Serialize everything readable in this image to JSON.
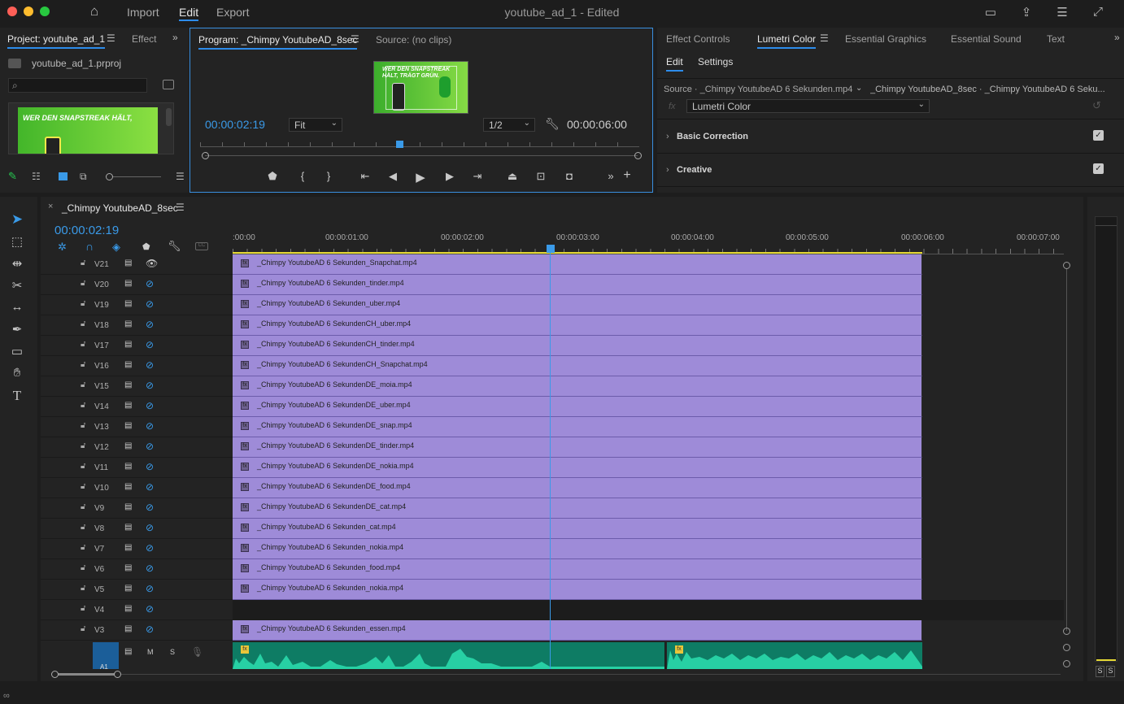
{
  "menubar": {
    "items": [
      {
        "label": "Import",
        "active": false
      },
      {
        "label": "Edit",
        "active": true
      },
      {
        "label": "Export",
        "active": false
      }
    ],
    "window_title": "youtube_ad_1 - Edited"
  },
  "project_panel": {
    "tab_label": "Project: youtube_ad_1",
    "tab2_label": "Effect",
    "file_name": "youtube_ad_1.prproj",
    "thumbnail_text": "WER DEN SNAPSTREAK HÄLT,"
  },
  "program_monitor": {
    "tab_label": "Program: _Chimpy YoutubeAD_8sec",
    "source_tab_label": "Source: (no clips)",
    "thumbnail_text": "WER DEN SNAPSTREAK HÄLT, TRÄGT GRÜN.",
    "current_time": "00:00:02:19",
    "zoom_select": "Fit",
    "resolution_select": "1/2",
    "duration": "00:00:06:00",
    "playhead_position": 0.46
  },
  "right_panel": {
    "tabs": [
      "Effect Controls",
      "Lumetri Color",
      "Essential Graphics",
      "Essential Sound",
      "Text"
    ],
    "active_tab": "Lumetri Color",
    "subtabs": [
      "Edit",
      "Settings"
    ],
    "source_label": "Source · _Chimpy YoutubeAD 6 Sekunden.mp4",
    "source_path": "_Chimpy YoutubeAD_8sec · _Chimpy YoutubeAD 6 Seku...",
    "fx_label": "fx",
    "effect_select": "Lumetri Color",
    "sections": [
      {
        "label": "Basic Correction",
        "checked": true
      },
      {
        "label": "Creative",
        "checked": true
      }
    ]
  },
  "timeline": {
    "tab_label": "_Chimpy YoutubeAD_8sec",
    "current_time": "00:00:02:19",
    "ruler_labels": [
      ":00:00",
      "00:00:01:00",
      "00:00:02:00",
      "00:00:03:00",
      "00:00:04:00",
      "00:00:05:00",
      "00:00:06:00",
      "00:00:07:00"
    ],
    "tracks": [
      {
        "name": "V21",
        "clip": "_Chimpy YoutubeAD 6 Sekunden_Snapchat.mp4",
        "visible": true
      },
      {
        "name": "V20",
        "clip": "_Chimpy YoutubeAD 6 Sekunden_tinder.mp4",
        "visible": false
      },
      {
        "name": "V19",
        "clip": "_Chimpy YoutubeAD 6 Sekunden_uber.mp4",
        "visible": false
      },
      {
        "name": "V18",
        "clip": "_Chimpy YoutubeAD 6 SekundenCH_uber.mp4",
        "visible": false
      },
      {
        "name": "V17",
        "clip": "_Chimpy YoutubeAD 6 SekundenCH_tinder.mp4",
        "visible": false
      },
      {
        "name": "V16",
        "clip": "_Chimpy YoutubeAD 6 SekundenCH_Snapchat.mp4",
        "visible": false
      },
      {
        "name": "V15",
        "clip": "_Chimpy YoutubeAD 6 SekundenDE_moia.mp4",
        "visible": false
      },
      {
        "name": "V14",
        "clip": "_Chimpy YoutubeAD 6 SekundenDE_uber.mp4",
        "visible": false
      },
      {
        "name": "V13",
        "clip": "_Chimpy YoutubeAD 6 SekundenDE_snap.mp4",
        "visible": false
      },
      {
        "name": "V12",
        "clip": "_Chimpy YoutubeAD 6 SekundenDE_tinder.mp4",
        "visible": false
      },
      {
        "name": "V11",
        "clip": "_Chimpy YoutubeAD 6 SekundenDE_nokia.mp4",
        "visible": false
      },
      {
        "name": "V10",
        "clip": "_Chimpy YoutubeAD 6 SekundenDE_food.mp4",
        "visible": false
      },
      {
        "name": "V9",
        "clip": "_Chimpy YoutubeAD 6 SekundenDE_cat.mp4",
        "visible": false
      },
      {
        "name": "V8",
        "clip": "_Chimpy YoutubeAD 6 Sekunden_cat.mp4",
        "visible": false
      },
      {
        "name": "V7",
        "clip": "_Chimpy YoutubeAD 6 Sekunden_nokia.mp4",
        "visible": false
      },
      {
        "name": "V6",
        "clip": "_Chimpy YoutubeAD 6 Sekunden_food.mp4",
        "visible": false
      },
      {
        "name": "V5",
        "clip": "_Chimpy YoutubeAD 6 Sekunden_nokia.mp4",
        "visible": false
      },
      {
        "name": "V4",
        "clip": "",
        "visible": false
      },
      {
        "name": "V3",
        "clip": "_Chimpy YoutubeAD 6 Sekunden_essen.mp4",
        "visible": false
      }
    ],
    "audio_track": {
      "name": "A1",
      "m": "M",
      "s": "S"
    },
    "meter_labels": [
      "S",
      "S"
    ]
  },
  "colors": {
    "accent": "#2d8ceb",
    "clip": "#9e8bd8",
    "audio": "#0e7c64",
    "wave": "#27d0a4"
  }
}
